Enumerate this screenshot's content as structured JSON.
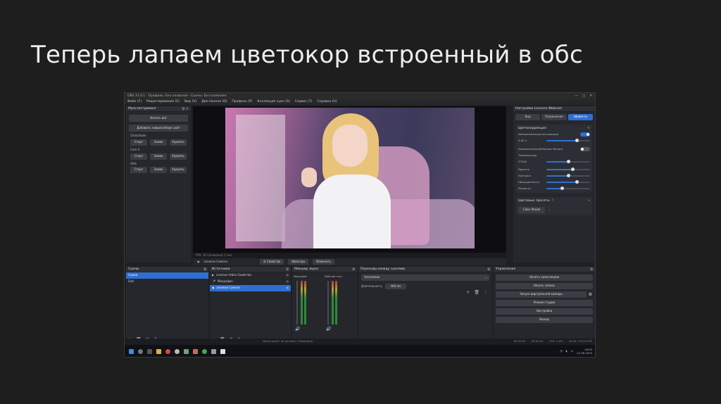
{
  "slide": {
    "title": "Теперь лапаем цветокор встроенный в обс"
  },
  "window": {
    "title": "OBS 31.0.1 - Профиль: Без названия - Сцены: Без названия",
    "controls": [
      "—",
      "□",
      "✕"
    ]
  },
  "menu": [
    "Файл (F)",
    "Редактирование (E)",
    "Вид (V)",
    "Док-панели (D)",
    "Профиль (P)",
    "Коллекция сцен (S)",
    "Сервис (T)",
    "Справка (H)"
  ],
  "multistream": {
    "title": "Мультистриминг",
    "start_all": "Начать всё",
    "add_target": "Добавить новый вебхук сайт",
    "groups": [
      {
        "name": "Chaturbate",
        "buttons": [
          "Старт",
          "Замок",
          "Удалить"
        ]
      },
      {
        "name": "Cam 4",
        "buttons": [
          "Старт",
          "Замок",
          "Удалить"
        ]
      },
      {
        "name": "Vkfe",
        "buttons": [
          "Старт",
          "Замок",
          "Удалить"
        ]
      }
    ]
  },
  "preview": {
    "status": "FPS: 30 (записано) 1 сек"
  },
  "source_bar": {
    "name": "Lovense Camera",
    "props": "Свойства",
    "filters": "Фильтры",
    "edit": "Изменить"
  },
  "properties": {
    "title": "Настройки Lovense Webcam",
    "tabs": [
      "Вид",
      "Разрешение",
      "Эффекты"
    ],
    "active_tab": 2,
    "color_section": {
      "title": "Цветокоррекция",
      "auto_exposure": "Автоматическая экспозиция",
      "exposure_value": "0.00 V",
      "auto_wb": "Автоматический баланс белого",
      "temperature": "Температура",
      "temperature_value": "5700K",
      "brightness": "Яркость",
      "contrast": "Контраст",
      "saturation": "Насыщенность",
      "sharpness": "Резкость"
    },
    "sliders": {
      "exposure": 0.7,
      "temperature": 0.5,
      "brightness": 0.6,
      "contrast": 0.5,
      "saturation": 0.7,
      "sharpness": 0.35
    },
    "toggles": {
      "auto_exposure": true,
      "auto_wb": false
    },
    "presets": {
      "title": "Цветовые пресеты",
      "preset": "Color Preset"
    }
  },
  "scenes": {
    "title": "Сцены",
    "items": [
      "Сцена",
      "Sink"
    ],
    "selected": 0
  },
  "sources": {
    "title": "Источники",
    "items": [
      "Lovense Video Свойства",
      "Микрофон",
      "Lovense Camera"
    ],
    "selected": 2
  },
  "mixer": {
    "title": "Микшер звука",
    "channels": [
      "Микрофон",
      "Рабочий стол"
    ],
    "levels": [
      0.45,
      0.3
    ]
  },
  "transitions": {
    "title": "Переходы между сценами",
    "type": "Затухание",
    "duration_label": "Длительность",
    "duration": "300 ms"
  },
  "controls": {
    "title": "Управление",
    "buttons": [
      "Начать трансляцию",
      "Начать запись",
      "Запуск виртуальной камеры",
      "Режим студии",
      "Настройки",
      "Выход"
    ]
  },
  "status": {
    "center": "Мониторинг не активен (Проверка)",
    "rec": "00:00:00",
    "live": "00:00:00",
    "cpu": "CPU: 1.4%",
    "fps": "30.00 / 30.00 FPS"
  },
  "taskbar": {
    "time": "16:05",
    "date": "21.06.2025"
  }
}
